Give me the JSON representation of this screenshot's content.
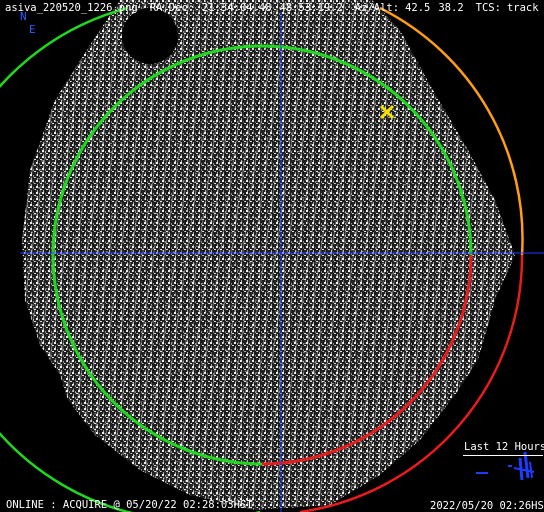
{
  "header": {
    "filename": "asiva_220520_1226.png",
    "radec_label": "RA,Dec:",
    "ra": "21:34:04.48",
    "dec": "48:53:19.2",
    "azalt_label": "Az/Alt:",
    "az": "42.5",
    "alt": "38.2",
    "tcs_label": "TCS:",
    "tcs_state": "track"
  },
  "compass": {
    "north": "N",
    "east": "E"
  },
  "history": {
    "label": "Last 12 Hours"
  },
  "status": {
    "left": "ONLINE : ACQUIRE @ 05/20/22 02:28:03HST",
    "right": "2022/05/20 02:26HST"
  },
  "colors": {
    "crosshair": "#1e3cff",
    "horizon_circle": "#1fd81f",
    "inner_circle": "#1fd81f",
    "dome_warning_arc": "#e81c1c",
    "dome_caution_arc": "#ff9d14",
    "target_marker": "#f5e000",
    "compass": "#2f5fff"
  },
  "icons": {
    "target": "target-x-icon"
  }
}
